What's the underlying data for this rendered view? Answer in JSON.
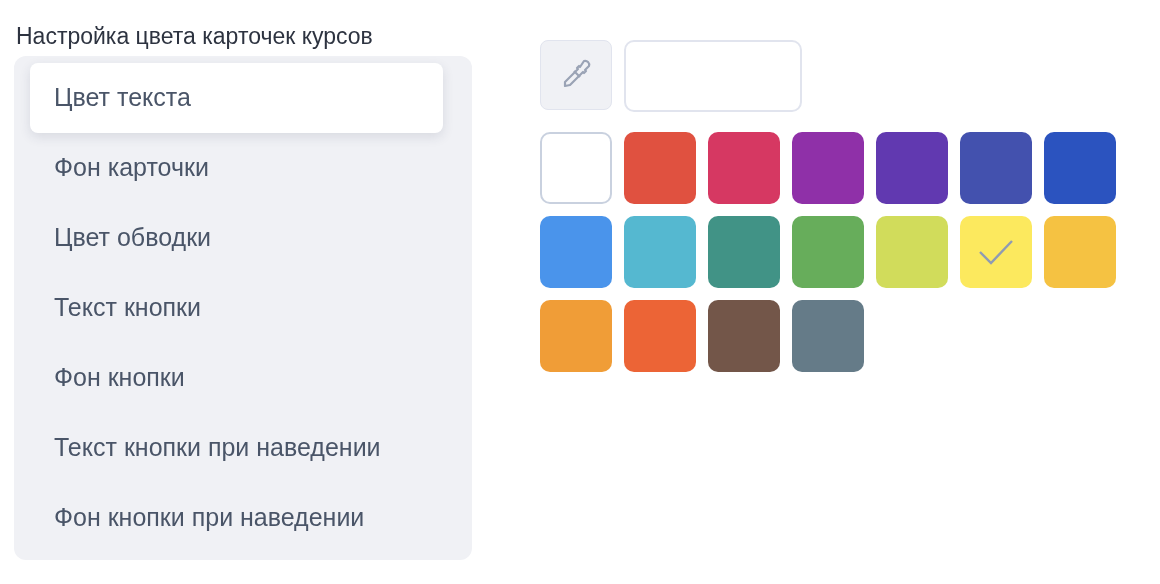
{
  "title": "Настройка цвета карточек курсов",
  "menu": [
    {
      "label": "Цвет текста",
      "selected": true
    },
    {
      "label": "Фон карточки",
      "selected": false
    },
    {
      "label": "Цвет обводки",
      "selected": false
    },
    {
      "label": "Текст кнопки",
      "selected": false
    },
    {
      "label": "Фон кнопки",
      "selected": false
    },
    {
      "label": "Текст кнопки при наведении",
      "selected": false
    },
    {
      "label": "Фон кнопки при наведении",
      "selected": false
    }
  ],
  "swatches": [
    {
      "color": "#ffffff",
      "selected": false
    },
    {
      "color": "#e05140",
      "selected": false
    },
    {
      "color": "#d63862",
      "selected": false
    },
    {
      "color": "#8f30a8",
      "selected": false
    },
    {
      "color": "#6139b0",
      "selected": false
    },
    {
      "color": "#4351ae",
      "selected": false
    },
    {
      "color": "#2b53bf",
      "selected": false
    },
    {
      "color": "#4a94eb",
      "selected": false
    },
    {
      "color": "#55b8d0",
      "selected": false
    },
    {
      "color": "#419386",
      "selected": false
    },
    {
      "color": "#67ad5b",
      "selected": false
    },
    {
      "color": "#d1dc5b",
      "selected": false
    },
    {
      "color": "#fce95e",
      "selected": true
    },
    {
      "color": "#f5c242",
      "selected": false
    },
    {
      "color": "#f09d37",
      "selected": false
    },
    {
      "color": "#ec6436",
      "selected": false
    },
    {
      "color": "#735649",
      "selected": false
    },
    {
      "color": "#657b88",
      "selected": false
    }
  ]
}
